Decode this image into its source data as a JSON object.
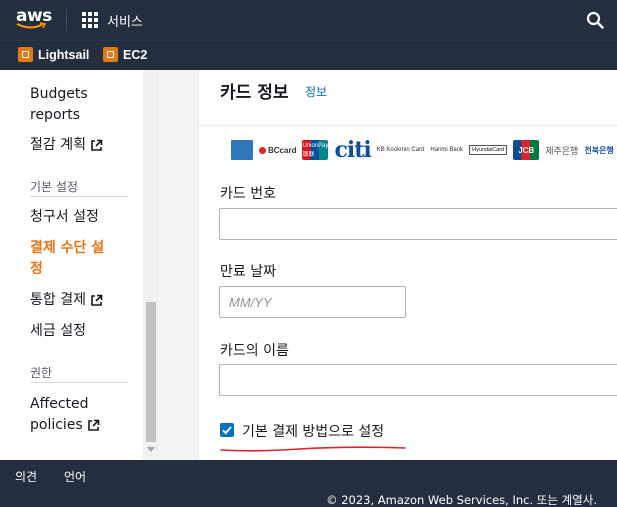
{
  "topbar": {
    "logo_text": "aws",
    "services_label": "서비스"
  },
  "favorites": [
    {
      "label": "Lightsail"
    },
    {
      "label": "EC2"
    }
  ],
  "sidebar": {
    "budgets_reports_line1": "Budgets",
    "budgets_reports_line2": "reports",
    "savings_plans": "절감 계획",
    "section_preferences": "기본 설정",
    "billing_preferences": "청구서 설정",
    "payment_methods_line1": "결제 수단 설",
    "payment_methods_line2": "정",
    "consolidated_billing": "통합 결제",
    "tax_settings": "세금 설정",
    "section_permissions": "권한",
    "affected_policies_line1": "Affected",
    "affected_policies_line2": "policies"
  },
  "main": {
    "title": "카드 정보",
    "info_link": "정보",
    "card_logos": {
      "bc": "BCcard",
      "unionpay": "UnionPay 银联",
      "citi": "citi",
      "kb": "KB Kookmin Card",
      "hanmi": "Hanmi Bank",
      "hyundai": "HyundaiCard",
      "jcb": "JCB",
      "jeju": "제주은행",
      "jeonbuk": "전북은행",
      "kb_short": "KB"
    },
    "card_number_label": "카드 번호",
    "card_number_value": "",
    "expiry_label": "만료 날짜",
    "expiry_placeholder": "MM/YY",
    "name_label": "카드의 이름",
    "name_value": "",
    "default_checkbox_label": "기본 결제 방법으로 설정",
    "default_checked": true
  },
  "footer": {
    "feedback": "의견",
    "language": "언어",
    "copyright": "© 2023, Amazon Web Services, Inc. 또는 계열사."
  },
  "colors": {
    "nav_bg": "#232f3e",
    "accent_orange": "#ec7211",
    "link_blue": "#0073bb",
    "annotation_red": "#e0232b"
  }
}
